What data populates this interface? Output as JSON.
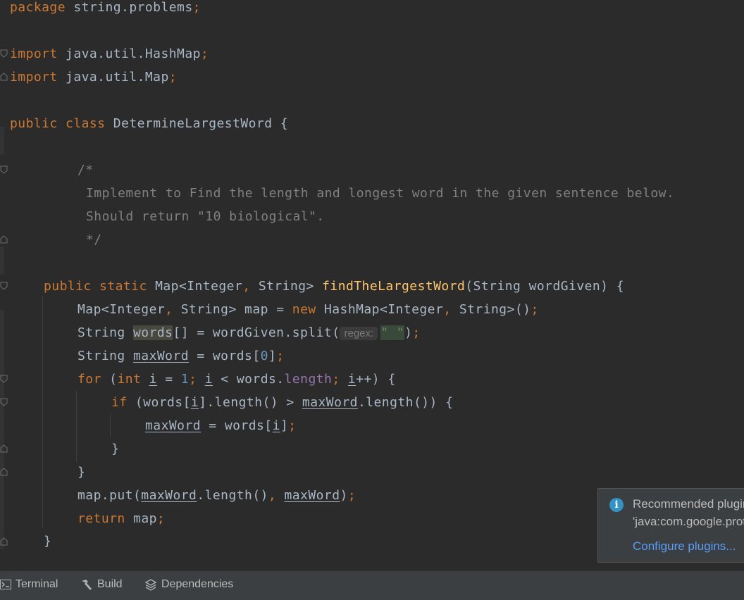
{
  "editor": {
    "code": {
      "package_kw": "package",
      "package_name": "string.problems",
      "import_kw": "import",
      "import1": "java.util.HashMap",
      "import2": "java.util.Map",
      "public_kw": "public",
      "class_kw": "class",
      "class_name": "DetermineLargestWord {",
      "comment_open": "/*",
      "comment_line1": "Implement to Find the length and longest word in the given sentence below.",
      "comment_line2": "Should return \"10 biological\".",
      "comment_close": "*/",
      "static_kw": "static",
      "return_type": "Map<Integer",
      "type_string": "String>",
      "method_name": "findTheLargestWord",
      "method_params": "(String wordGiven) {",
      "l14_a": "Map<Integer",
      "l14_b": "String> map = ",
      "new_kw": "new",
      "l14_c": "HashMap<Integer",
      "l14_d": "String>()",
      "l15_type": "String ",
      "l15_var": "words",
      "l15_mid": "[] = wordGiven.split(",
      "hint_regex": "regex:",
      "l15_str": "\" \"",
      "l15_end": ")",
      "l16_type": "String ",
      "l16_var": "maxWord",
      "l16_mid": " = words[",
      "num_zero": "0",
      "l16_end": "]",
      "for_kw": "for",
      "int_kw": "int",
      "var_i": "i",
      "num_one": "1",
      "length_field": "length",
      "if_kw": "if",
      "l18_mid": ".length() > ",
      "l18_end": ".length()) {",
      "l19_mid": " = words[",
      "close_brace": "}",
      "l22_a": "map.put(",
      "l22_b": ".length()",
      "return_kw": "return",
      "return_val": "map"
    }
  },
  "notification": {
    "title": "Recommended plugins",
    "subtitle": "'java:com.google.protobuf'",
    "action": "Configure plugins..."
  },
  "toolwindows": {
    "terminal": "Terminal",
    "build": "Build",
    "dependencies": "Dependencies"
  }
}
